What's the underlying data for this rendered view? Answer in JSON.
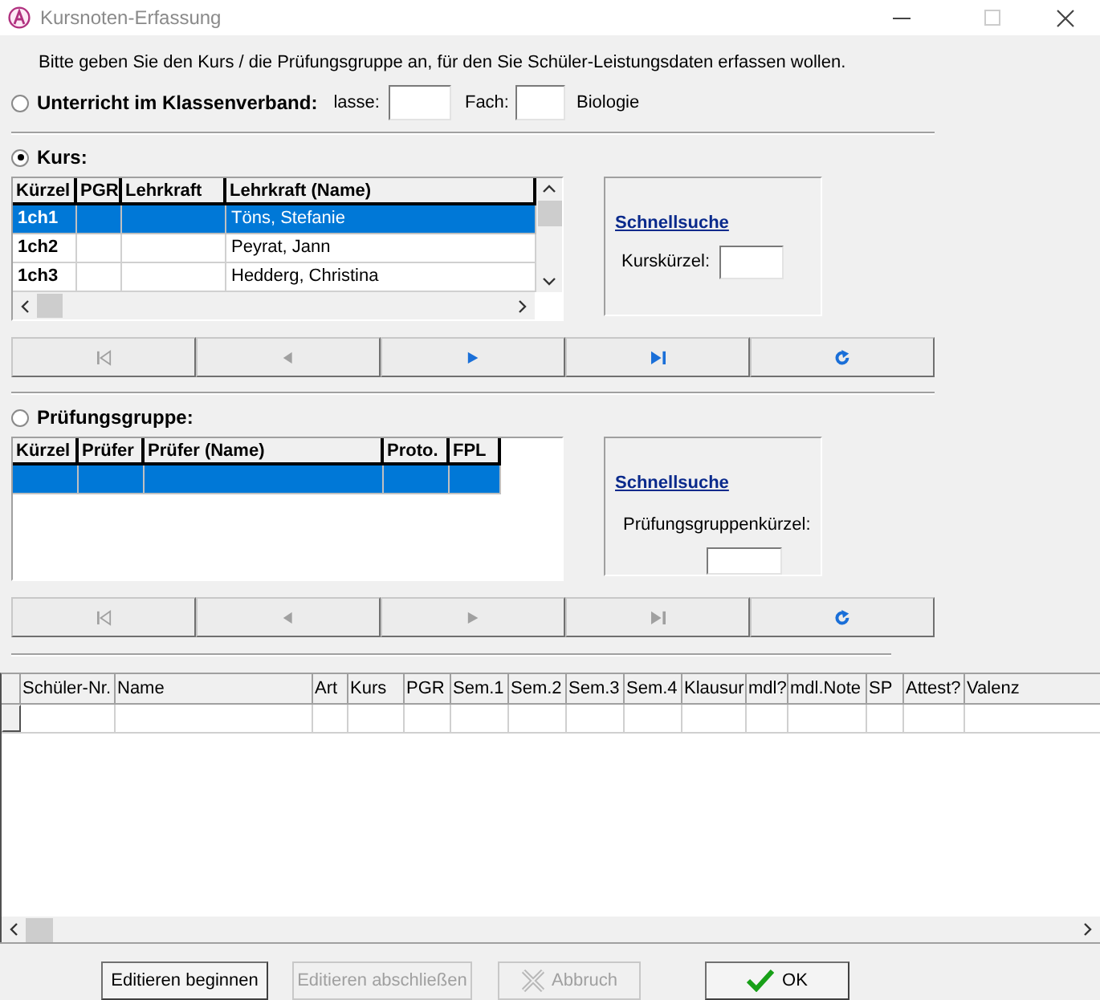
{
  "window": {
    "title": "Kursnoten-Erfassung"
  },
  "instruction": "Bitte geben Sie den Kurs / die Prüfungsgruppe an, für den Sie Schüler-Leistungsdaten erfassen wollen.",
  "class_option": {
    "label": "Unterricht im Klassenverband:",
    "selected": false,
    "klasse_label": "lasse:",
    "fach_label": "Fach:",
    "subject": "Biologie"
  },
  "kurs": {
    "label": "Kurs:",
    "selected": true,
    "columns": [
      "Kürzel",
      "PGR",
      "Lehrkraft",
      "Lehrkraft (Name)"
    ],
    "rows": [
      {
        "cells": [
          "1ch1",
          "",
          "",
          "Töns, Stefanie"
        ],
        "selected": true
      },
      {
        "cells": [
          "1ch2",
          "",
          "",
          "Peyrat, Jann"
        ],
        "selected": false
      },
      {
        "cells": [
          "1ch3",
          "",
          "",
          "Hedderg, Christina"
        ],
        "selected": false
      }
    ],
    "quick_search": {
      "title": "Schnellsuche",
      "label": "Kurskürzel:"
    },
    "nav": [
      {
        "kind": "first",
        "disabled": true
      },
      {
        "kind": "prev",
        "disabled": true
      },
      {
        "kind": "next",
        "disabled": false
      },
      {
        "kind": "last",
        "disabled": false
      },
      {
        "kind": "refresh",
        "disabled": false
      }
    ]
  },
  "pruefungsgruppe": {
    "label": "Prüfungsgruppe:",
    "selected": false,
    "columns": [
      "Kürzel",
      "Prüfer",
      "Prüfer (Name)",
      "Proto.",
      "FPL"
    ],
    "rows": [
      {
        "selected": true
      }
    ],
    "quick_search": {
      "title": "Schnellsuche",
      "label": "Prüfungsgruppenkürzel:"
    },
    "nav": [
      {
        "kind": "first",
        "disabled": true
      },
      {
        "kind": "prev",
        "disabled": true
      },
      {
        "kind": "next",
        "disabled": true
      },
      {
        "kind": "last",
        "disabled": true
      },
      {
        "kind": "refresh",
        "disabled": false
      }
    ]
  },
  "grid": {
    "columns": [
      "Schüler-Nr.",
      "Name",
      "Art",
      "Kurs",
      "PGR",
      "Sem.1",
      "Sem.2",
      "Sem.3",
      "Sem.4",
      "Klausur",
      "mdl?",
      "mdl.Note",
      "SP",
      "Attest?",
      "Valenz"
    ]
  },
  "buttons": [
    {
      "label": "Editieren beginnen",
      "kind": "plain",
      "disabled": false
    },
    {
      "label": "Editieren abschließen",
      "kind": "plain",
      "disabled": true
    },
    {
      "label": "Abbruch",
      "kind": "cancel",
      "disabled": true
    },
    {
      "label": "OK",
      "kind": "ok",
      "disabled": false
    }
  ]
}
